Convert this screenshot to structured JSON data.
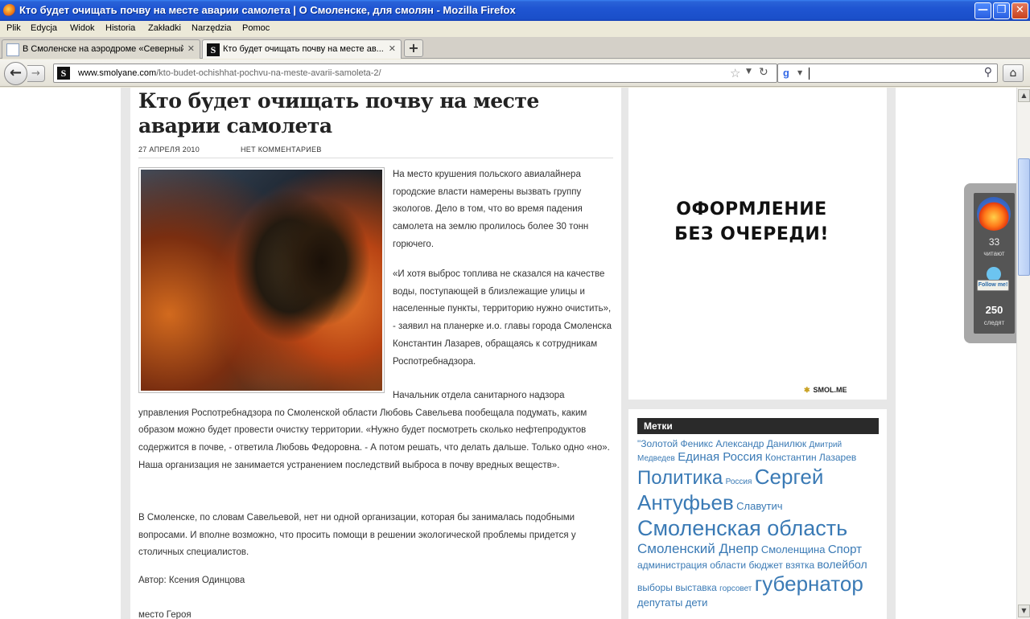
{
  "window": {
    "title": "Кто будет очищать почву на месте аварии самолета | О Смоленске, для смолян - Mozilla Firefox"
  },
  "menu": [
    "Plik",
    "Edycja",
    "Widok",
    "Historia",
    "Zakładki",
    "Narzędzia",
    "Pomoc"
  ],
  "tabs": [
    {
      "label": "В Смоленске на аэродроме «Северный» ..."
    },
    {
      "label": "Кто будет очищать почву на месте ав..."
    }
  ],
  "tab_close": "✕",
  "new_tab": "+",
  "nav": {
    "back": "←",
    "forward": "→",
    "favicon": "S",
    "url_domain": "www.smolyane.com",
    "url_path": "/kto-budet-ochishhat-pochvu-na-meste-avarii-samoleta-2/",
    "search_engine": "g",
    "search_value": "",
    "home": "⌂"
  },
  "article": {
    "title": "Кто будет очищать почву на месте аварии самолета",
    "date": "27 АПРЕЛЯ 2010",
    "comments": "НЕТ КОММЕНТАРИЕВ",
    "p1": "На место крушения польского авиалайнера городские власти намерены вызвать группу экологов. Дело в том, что во время падения самолета на землю пролилось более 30 тонн горючего.",
    "p2": "«И хотя выброс топлива не сказался на качестве воды, поступающей в близлежащие улицы и населенные пункты, территорию нужно очистить», - заявил на планерке и.о. главы города Смоленска Константин Лазарев, обращаясь к сотрудникам Роспотребнадзора.",
    "p3": "Начальник отдела санитарного надзора управления Роспотребнадзора по Смоленской области Любовь Савельева пообещала подумать, каким образом можно будет провести очистку территории. «Нужно будет посмотреть сколько нефтепродуктов содержится в почве, - ответила Любовь Федоровна. - А потом решать, что делать дальше. Только одно «но». Наша организация не занимается устранением последствий выброса в почву вредных веществ».",
    "p4": "В Смоленске, по словам Савельевой, нет ни одной организации, которая бы занималась подобными вопросами. И вполне возможно, что просить помощи в решении экологической проблемы придется у столичных специалистов.",
    "author": "Автор: Ксения Одинцова",
    "source": "место Героя"
  },
  "ad": {
    "line1": "ОФОРМЛЕНИЕ",
    "line2": "БЕЗ ОЧЕРЕДИ!",
    "brand": "SMOL.ME"
  },
  "tags_widget": {
    "heading": "Метки",
    "tags": [
      {
        "text": "\"Золотой Феникс",
        "size": 12
      },
      {
        "text": "Александр Данилюк",
        "size": 12
      },
      {
        "text": "Дмитрий Медведев",
        "size": 10
      },
      {
        "text": "Единая Россия",
        "size": 15
      },
      {
        "text": "Константин Лазарев",
        "size": 12
      },
      {
        "text": "Политика",
        "size": 24
      },
      {
        "text": "Россия",
        "size": 10
      },
      {
        "text": "Сергей Антуфьев",
        "size": 26
      },
      {
        "text": "Славутич",
        "size": 13
      },
      {
        "text": "Смоленская область",
        "size": 27
      },
      {
        "text": "Смоленский Днепр",
        "size": 17
      },
      {
        "text": "Смоленщина",
        "size": 13
      },
      {
        "text": "Спорт",
        "size": 15
      },
      {
        "text": "администрация области",
        "size": 12
      },
      {
        "text": "бюджет",
        "size": 12
      },
      {
        "text": "взятка",
        "size": 12
      },
      {
        "text": "волейбол",
        "size": 14
      },
      {
        "text": "выборы",
        "size": 12
      },
      {
        "text": "выставка",
        "size": 12
      },
      {
        "text": "горсовет",
        "size": 10
      },
      {
        "text": "губернатор",
        "size": 26
      },
      {
        "text": "депутаты",
        "size": 13
      },
      {
        "text": "дети",
        "size": 13
      }
    ]
  },
  "feed_widget": {
    "readers": "33",
    "readers_label": "читают",
    "follow_sign": "Follow me!",
    "followers": "250",
    "followers_label": "следят"
  }
}
